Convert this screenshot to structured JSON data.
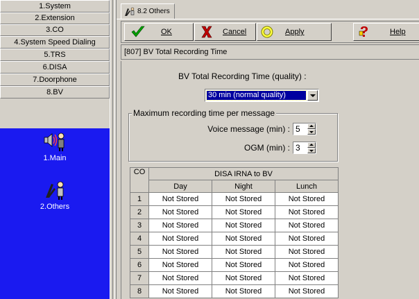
{
  "sidebar": {
    "items": [
      {
        "label": "1.System"
      },
      {
        "label": "2.Extension"
      },
      {
        "label": "3.CO"
      },
      {
        "label": "4.System Speed Dialing"
      },
      {
        "label": "5.TRS"
      },
      {
        "label": "6.DISA"
      },
      {
        "label": "7.Doorphone"
      },
      {
        "label": "8.BV"
      }
    ],
    "subitems": [
      {
        "label": "1.Main",
        "icon": "speaker-person-icon"
      },
      {
        "label": "2.Others",
        "icon": "wrench-person-icon"
      }
    ]
  },
  "tab": {
    "label": "8.2 Others"
  },
  "toolbar": {
    "ok_label": "OK",
    "cancel_label": "Cancel",
    "apply_label": "Apply",
    "help_label": "Help"
  },
  "title_field": "[807] BV Total Recording Time",
  "quality": {
    "label": "BV Total Recording Time (quality) :",
    "selected": "30 min (normal quality)"
  },
  "max_group": {
    "title": "Maximum recording time per message",
    "voice_label": "Voice message (min) :",
    "voice_value": "5",
    "ogm_label": "OGM (min) :",
    "ogm_value": "3"
  },
  "table": {
    "co_header": "CO",
    "group_header": "DISA IRNA to BV",
    "columns": [
      "Day",
      "Night",
      "Lunch"
    ],
    "rows": [
      {
        "co": "1",
        "cells": [
          "Not Stored",
          "Not Stored",
          "Not Stored"
        ]
      },
      {
        "co": "2",
        "cells": [
          "Not Stored",
          "Not Stored",
          "Not Stored"
        ]
      },
      {
        "co": "3",
        "cells": [
          "Not Stored",
          "Not Stored",
          "Not Stored"
        ]
      },
      {
        "co": "4",
        "cells": [
          "Not Stored",
          "Not Stored",
          "Not Stored"
        ]
      },
      {
        "co": "5",
        "cells": [
          "Not Stored",
          "Not Stored",
          "Not Stored"
        ]
      },
      {
        "co": "6",
        "cells": [
          "Not Stored",
          "Not Stored",
          "Not Stored"
        ]
      },
      {
        "co": "7",
        "cells": [
          "Not Stored",
          "Not Stored",
          "Not Stored"
        ]
      },
      {
        "co": "8",
        "cells": [
          "Not Stored",
          "Not Stored",
          "Not Stored"
        ]
      }
    ]
  },
  "colors": {
    "panel": "#1a1af0",
    "selection": "#0000a0",
    "face": "#d4d0c8"
  }
}
